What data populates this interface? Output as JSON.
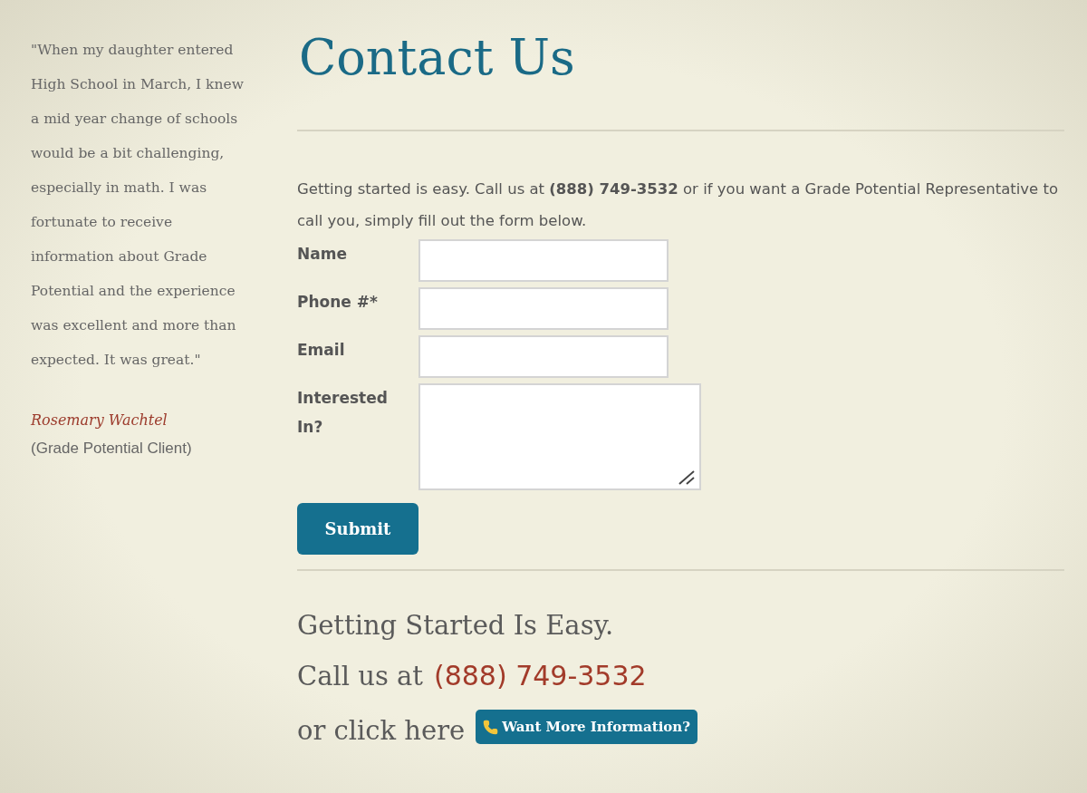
{
  "testimonial": {
    "quote": "\"When my daughter entered High School in March, I knew a mid year change of schools would be a bit challenging, especially in math. I was fortunate to receive information about Grade Potential and the experience was excellent and more than expected. It was great.\"",
    "author": "Rosemary Wachtel",
    "role": "(Grade Potential Client)"
  },
  "title": "Contact Us",
  "intro": "Getting started is easy. Call us at **(888) 749-3532** or if you want a Grade Potential Representative to call you, simply fill out the form below.",
  "form": {
    "fields": [
      {
        "label": "Name",
        "kind": "input"
      },
      {
        "label": "Phone #*",
        "kind": "input"
      },
      {
        "label": "Email",
        "kind": "input"
      },
      {
        "label": "Interested In?",
        "kind": "textarea"
      }
    ],
    "submit": "Submit"
  },
  "footer": {
    "heading": "Getting Started Is Easy.",
    "call_prefix": "Call us at",
    "phone": "(888) 749-3532",
    "click_text": "or click here",
    "button": "Want More Information?"
  }
}
